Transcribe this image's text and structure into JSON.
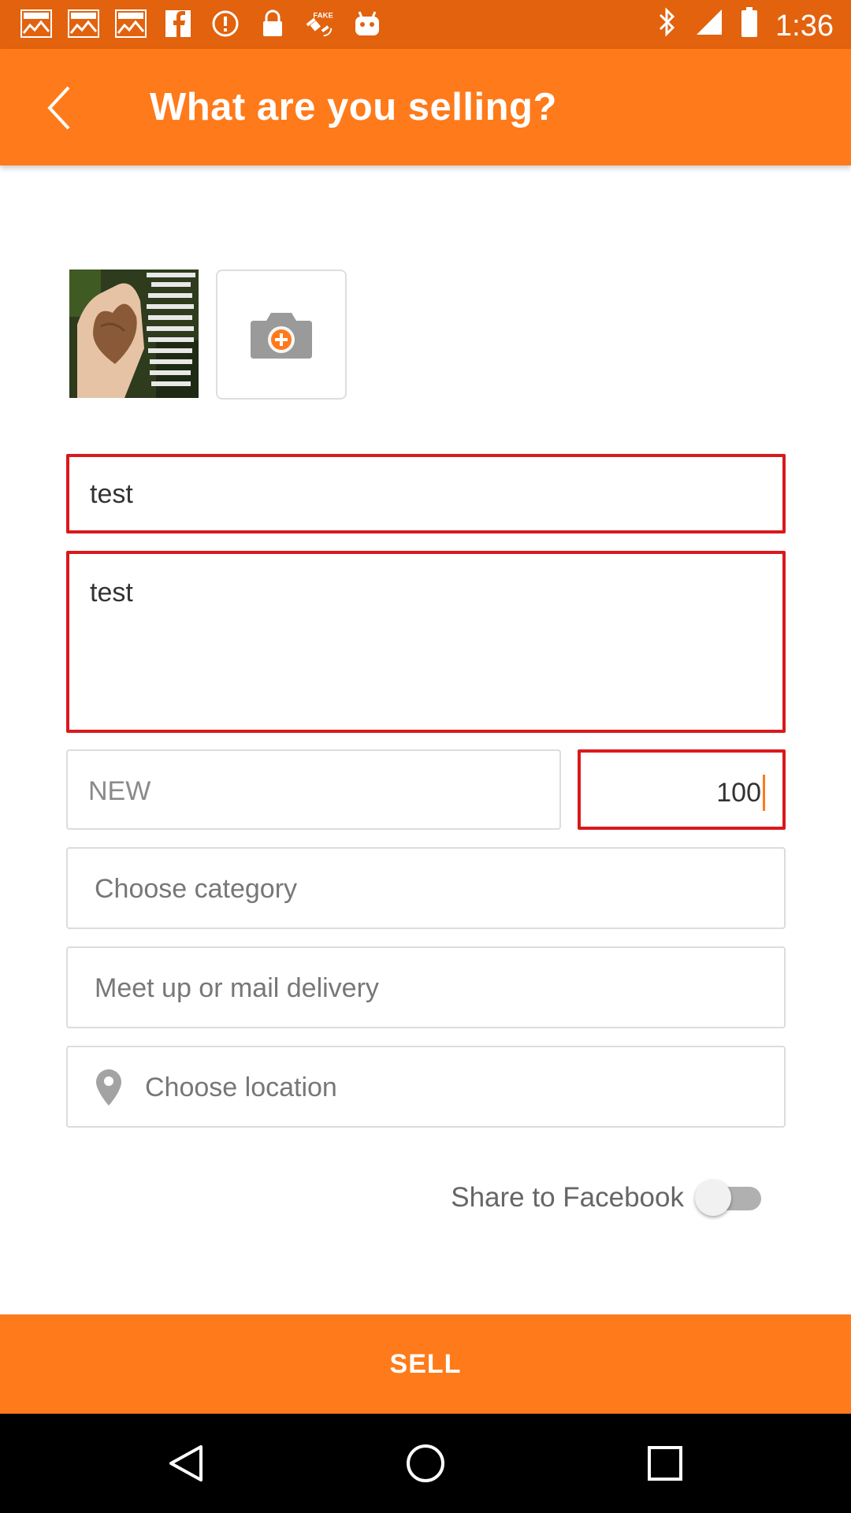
{
  "status_bar": {
    "time": "1:36",
    "icons": [
      "ifl-markets-icon",
      "ifl-markets-icon",
      "ifl-markets-icon",
      "facebook-icon",
      "alert-icon",
      "lock-icon",
      "fake-gps-icon",
      "android-icon",
      "bluetooth-icon",
      "signal-icon",
      "battery-icon"
    ]
  },
  "header": {
    "title": "What are you selling?",
    "back_icon": "back-arrow-icon"
  },
  "photos": {
    "thumbnail_caption": "ifl-markets-icon",
    "add_icon": "camera-add-icon"
  },
  "form": {
    "title_value": "test",
    "description_value": "test",
    "condition_value": "NEW",
    "price_value": "100",
    "category_placeholder": "Choose category",
    "delivery_placeholder": "Meet up or mail delivery",
    "location_placeholder": "Choose location"
  },
  "share": {
    "label": "Share to Facebook",
    "enabled": false
  },
  "actions": {
    "sell_label": "SELL"
  },
  "colors": {
    "accent": "#ff7a1a",
    "status_bar": "#e2620e",
    "error": "#d9191c"
  }
}
